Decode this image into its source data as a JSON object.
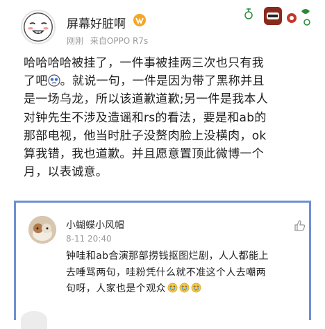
{
  "post": {
    "username": "屏幕好脏啊",
    "time": "刚刚",
    "source": "来自OPPO R7s",
    "body_lines": [
      "哈哈哈哈被挂了，一件事被挂两三次也只有我",
      "了吧",
      "是一场乌龙，所以该道歉道歉;另一件是我本人",
      "对钟先生不涉及造谣和rs的看法，要是和ab的",
      "那部电视，他当时肚子没赘肉脸上没横肉，ok",
      "算我错，我也道歉。并且愿意置顶此微博一个",
      "月，以表诚意。"
    ],
    "body_line2_after_emoji": "。就说一句，一件是因为带了黑称并且"
  },
  "comment": {
    "username": "小蝴蝶小风帽",
    "time": "8-11 20:40",
    "text_lines": [
      "钟哇和ab合演那部捞钱抠图烂剧，人人都能上",
      "去唾骂两句，哇粉凭什么就不准这个人去嘲两",
      "句呀，人家也是个观众"
    ]
  },
  "icons": {
    "vip": "vip-badge-icon",
    "post_decor": "card-decoration-icon",
    "inline_emoji": "face-emoji-icon",
    "cry": "crying-emoji-icon",
    "like": "thumbs-up-icon"
  },
  "colors": {
    "comment_border": "#6f8fd0",
    "meta_gray": "#9a9a9a"
  }
}
